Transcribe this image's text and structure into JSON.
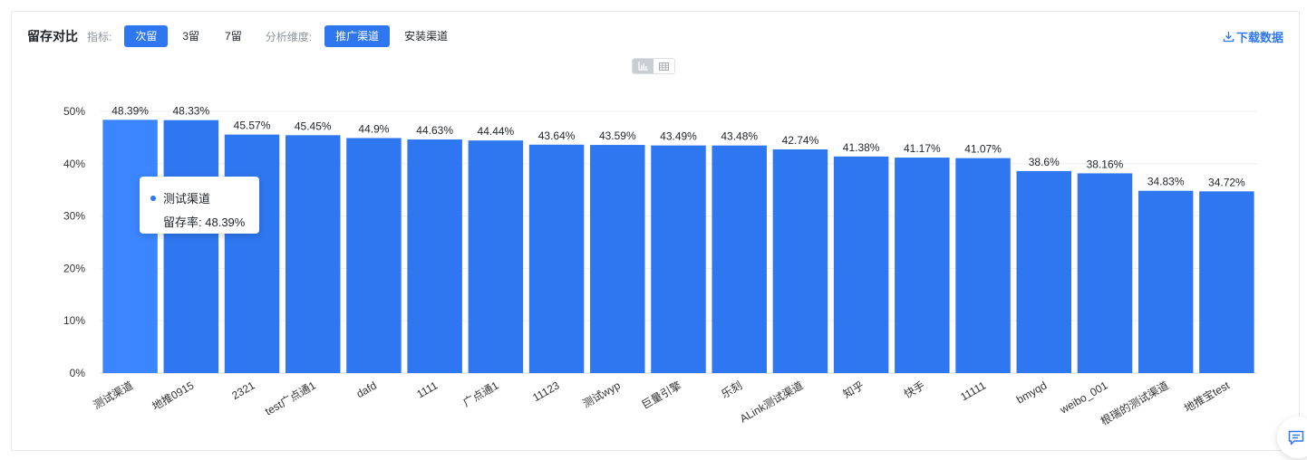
{
  "toolbar": {
    "title": "留存对比",
    "metric_label": "指标:",
    "metric_options": [
      "次留",
      "3留",
      "7留"
    ],
    "metric_selected": "次留",
    "dimension_label": "分析维度:",
    "dimension_options": [
      "推广渠道",
      "安装渠道"
    ],
    "dimension_selected": "推广渠道",
    "download_label": "下载数据"
  },
  "view_switch": {
    "selected": "bar-chart",
    "icons": [
      "bar-chart-icon",
      "table-icon"
    ]
  },
  "tooltip": {
    "series": "测试渠道",
    "metric": "留存率",
    "value": "48.39%"
  },
  "colors": {
    "accent": "#2f77f1",
    "bar": "#2f77f1",
    "bar_highlight": "#3b86ff"
  },
  "chart_data": {
    "type": "bar",
    "categories": [
      "测试渠道",
      "地推0915",
      "2321",
      "test广点通1",
      "dafd",
      "1111",
      "广点通1",
      "11123",
      "测试wyp",
      "巨量引擎",
      "乐刻",
      "ALink测试渠道",
      "知乎",
      "快手",
      "11111",
      "bmyqd",
      "weibo_001",
      "根瑞的测试渠道",
      "地推宝test"
    ],
    "values": [
      48.39,
      48.33,
      45.57,
      45.45,
      44.9,
      44.63,
      44.44,
      43.64,
      43.59,
      43.49,
      43.48,
      42.74,
      41.38,
      41.17,
      41.07,
      38.6,
      38.16,
      34.83,
      34.72
    ],
    "data_labels": [
      "48.39%",
      "48.33%",
      "45.57%",
      "45.45%",
      "44.9%",
      "44.63%",
      "44.44%",
      "43.64%",
      "43.59%",
      "43.49%",
      "43.48%",
      "42.74%",
      "41.38%",
      "41.17%",
      "41.07%",
      "38.6%",
      "38.16%",
      "34.83%",
      "34.72%"
    ],
    "yticks": [
      "0%",
      "10%",
      "20%",
      "30%",
      "40%",
      "50%"
    ],
    "ylim": [
      0,
      50
    ],
    "highlighted_index": 0,
    "grid": true,
    "title": "",
    "xlabel": "",
    "ylabel": ""
  }
}
